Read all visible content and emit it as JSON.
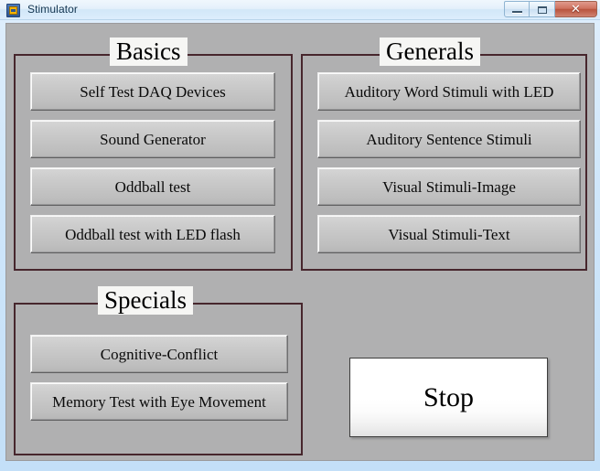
{
  "window": {
    "title": "Stimulator",
    "icon": "labview-app-icon",
    "controls": {
      "minimize_label": "–",
      "maximize_label": "❐",
      "close_label": "✕"
    },
    "colors": {
      "panel_background": "#b0b0b1",
      "group_border": "#47262d",
      "button_face": "#c6c6c6",
      "stop_button_face": "#ffffff",
      "titlebar": "#dcedfc"
    }
  },
  "groups": [
    {
      "id": "basics",
      "title": "Basics",
      "buttons": [
        {
          "id": "self-test-daq-devices",
          "label": "Self Test DAQ Devices"
        },
        {
          "id": "sound-generator",
          "label": "Sound Generator"
        },
        {
          "id": "oddball-test",
          "label": "Oddball test"
        },
        {
          "id": "oddball-test-with-led-flash",
          "label": "Oddball test with LED flash"
        }
      ]
    },
    {
      "id": "generals",
      "title": "Generals",
      "buttons": [
        {
          "id": "auditory-word-stimuli-with-led",
          "label": "Auditory Word Stimuli with LED"
        },
        {
          "id": "auditory-sentence-stimuli",
          "label": "Auditory Sentence Stimuli"
        },
        {
          "id": "visual-stimuli-image",
          "label": "Visual Stimuli-Image"
        },
        {
          "id": "visual-stimuli-text",
          "label": "Visual Stimuli-Text"
        }
      ]
    },
    {
      "id": "specials",
      "title": "Specials",
      "buttons": [
        {
          "id": "cognitive-conflict",
          "label": "Cognitive-Conflict"
        },
        {
          "id": "memory-test-with-eye-movement",
          "label": "Memory Test with Eye Movement"
        }
      ]
    }
  ],
  "stop_button": {
    "label": "Stop"
  }
}
